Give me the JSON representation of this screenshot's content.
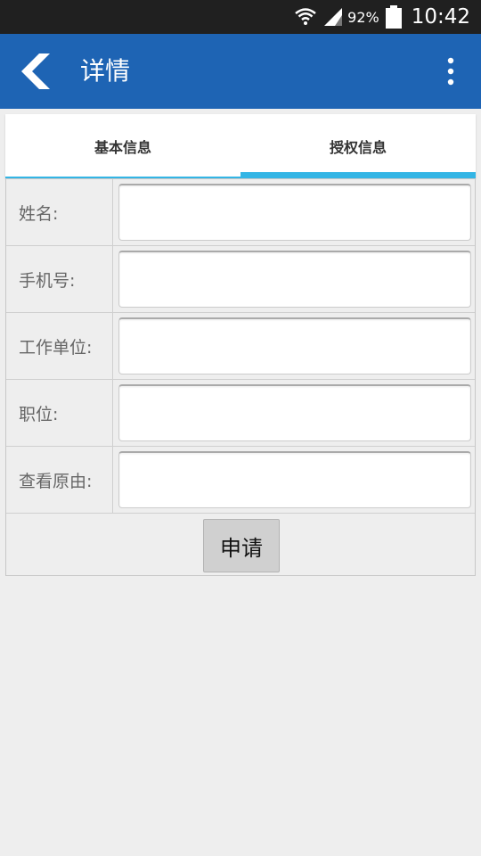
{
  "status_bar": {
    "battery_percent": "92%",
    "time": "10:42"
  },
  "app_bar": {
    "title": "详情",
    "back_icon": "chevron-left-icon",
    "menu_icon": "more-vertical-icon"
  },
  "tabs": [
    {
      "label": "基本信息",
      "selected": false
    },
    {
      "label": "授权信息",
      "selected": true
    }
  ],
  "form": {
    "fields": [
      {
        "label": "姓名:",
        "value": ""
      },
      {
        "label": "手机号:",
        "value": ""
      },
      {
        "label": "工作单位:",
        "value": ""
      },
      {
        "label": "职位:",
        "value": ""
      },
      {
        "label": "查看原由:",
        "value": ""
      }
    ],
    "submit_label": "申请"
  },
  "colors": {
    "app_bar": "#1e64b4",
    "tab_indicator": "#33b5e5",
    "background": "#eeeeee"
  }
}
